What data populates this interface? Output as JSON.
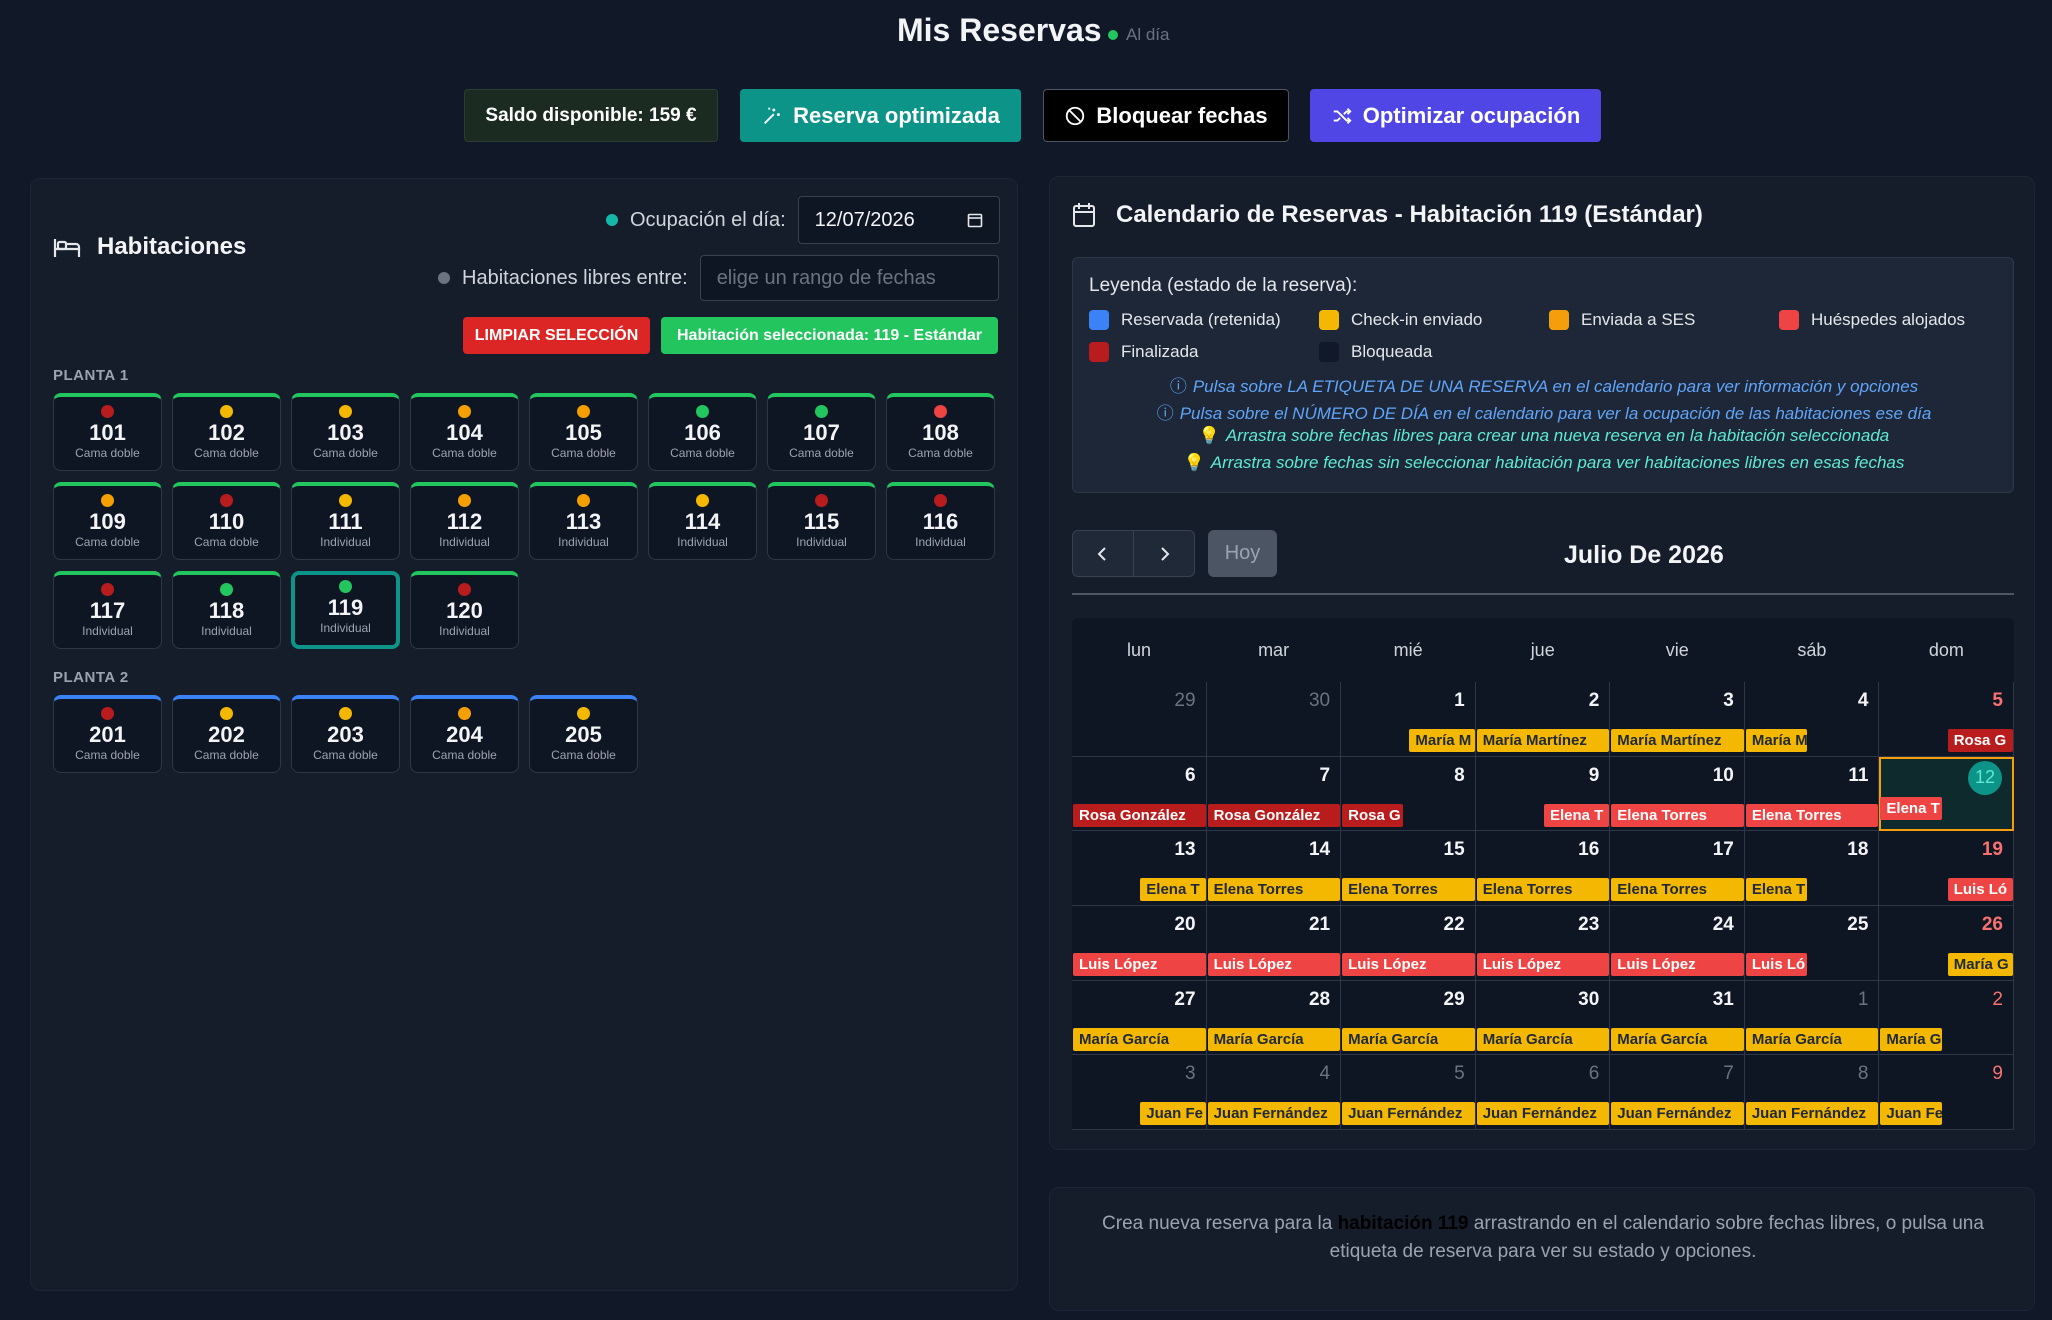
{
  "header": {
    "title": "Mis Reservas",
    "status": "Al día"
  },
  "toolbar": {
    "saldo": "Saldo disponible: 159 €",
    "reserva_optimizada": "Reserva optimizada",
    "bloquear_fechas": "Bloquear fechas",
    "optimizar_ocupacion": "Optimizar ocupación"
  },
  "rooms_panel": {
    "title": "Habitaciones",
    "occupancy_label": "Ocupación el día:",
    "occupancy_date": "12/07/2026",
    "free_label": "Habitaciones libres entre:",
    "free_placeholder": "elige un rango de fechas",
    "clear_button": "LIMPIAR SELECCIÓN",
    "selected_badge": "Habitación seleccionada: 119 - Estándar",
    "floors": [
      {
        "label": "PLANTA 1",
        "rooms": [
          {
            "number": "101",
            "type": "Cama doble",
            "status_color": "#b91c1c"
          },
          {
            "number": "102",
            "type": "Cama doble",
            "status_color": "#f5b800"
          },
          {
            "number": "103",
            "type": "Cama doble",
            "status_color": "#f5b800"
          },
          {
            "number": "104",
            "type": "Cama doble",
            "status_color": "#f5a000"
          },
          {
            "number": "105",
            "type": "Cama doble",
            "status_color": "#f5a000"
          },
          {
            "number": "106",
            "type": "Cama doble",
            "status_color": "#22c55e"
          },
          {
            "number": "107",
            "type": "Cama doble",
            "status_color": "#22c55e"
          },
          {
            "number": "108",
            "type": "Cama doble",
            "status_color": "#ef4444"
          },
          {
            "number": "109",
            "type": "Cama doble",
            "status_color": "#f5a000"
          },
          {
            "number": "110",
            "type": "Cama doble",
            "status_color": "#b91c1c"
          },
          {
            "number": "111",
            "type": "Individual",
            "status_color": "#f5b800"
          },
          {
            "number": "112",
            "type": "Individual",
            "status_color": "#f5a000"
          },
          {
            "number": "113",
            "type": "Individual",
            "status_color": "#f5a000"
          },
          {
            "number": "114",
            "type": "Individual",
            "status_color": "#f5b800"
          },
          {
            "number": "115",
            "type": "Individual",
            "status_color": "#b91c1c"
          },
          {
            "number": "116",
            "type": "Individual",
            "status_color": "#b91c1c"
          },
          {
            "number": "117",
            "type": "Individual",
            "status_color": "#b91c1c"
          },
          {
            "number": "118",
            "type": "Individual",
            "status_color": "#22c55e"
          },
          {
            "number": "119",
            "type": "Individual",
            "status_color": "#22c55e",
            "selected": true
          },
          {
            "number": "120",
            "type": "Individual",
            "status_color": "#b91c1c"
          }
        ]
      },
      {
        "label": "PLANTA 2",
        "rooms": [
          {
            "number": "201",
            "type": "Cama doble",
            "status_color": "#b91c1c"
          },
          {
            "number": "202",
            "type": "Cama doble",
            "status_color": "#f5b800"
          },
          {
            "number": "203",
            "type": "Cama doble",
            "status_color": "#f5b800"
          },
          {
            "number": "204",
            "type": "Cama doble",
            "status_color": "#f5a000"
          },
          {
            "number": "205",
            "type": "Cama doble",
            "status_color": "#f5b800"
          }
        ]
      }
    ]
  },
  "calendar": {
    "title": "Calendario de Reservas - Habitación 119 (Estándar)",
    "legend_title": "Leyenda (estado de la reserva):",
    "legend": [
      {
        "label": "Reservada (retenida)",
        "color": "#3b82f6"
      },
      {
        "label": "Check-in enviado",
        "color": "#f5b800"
      },
      {
        "label": "Enviada a SES",
        "color": "#f59e0b"
      },
      {
        "label": "Huéspedes alojados",
        "color": "#ef4444"
      },
      {
        "label": "Finalizada",
        "color": "#b91c1c"
      },
      {
        "label": "Bloqueada",
        "color": "#111827"
      }
    ],
    "hints": [
      "Pulsa sobre LA ETIQUETA DE UNA RESERVA en el calendario para ver información y opciones",
      "Pulsa sobre el NÚMERO DE DÍA en el calendario para ver la ocupación de las habitaciones ese día",
      "Arrastra sobre fechas libres para crear una nueva reserva en la habitación seleccionada",
      "Arrastra sobre fechas sin seleccionar habitación para ver habitaciones libres en esas fechas"
    ],
    "today_button": "Hoy",
    "month_title": "Julio De 2026",
    "weekdays": [
      "lun",
      "mar",
      "mié",
      "jue",
      "vie",
      "sáb",
      "dom"
    ],
    "weeks": [
      [
        {
          "d": "29",
          "o": true
        },
        {
          "d": "30",
          "o": true
        },
        {
          "d": "1"
        },
        {
          "d": "2"
        },
        {
          "d": "3"
        },
        {
          "d": "4"
        },
        {
          "d": "5"
        }
      ],
      [
        {
          "d": "6"
        },
        {
          "d": "7"
        },
        {
          "d": "8"
        },
        {
          "d": "9"
        },
        {
          "d": "10"
        },
        {
          "d": "11"
        },
        {
          "d": "12",
          "today": true
        }
      ],
      [
        {
          "d": "13"
        },
        {
          "d": "14"
        },
        {
          "d": "15"
        },
        {
          "d": "16"
        },
        {
          "d": "17"
        },
        {
          "d": "18"
        },
        {
          "d": "19"
        }
      ],
      [
        {
          "d": "20"
        },
        {
          "d": "21"
        },
        {
          "d": "22"
        },
        {
          "d": "23"
        },
        {
          "d": "24"
        },
        {
          "d": "25"
        },
        {
          "d": "26"
        }
      ],
      [
        {
          "d": "27"
        },
        {
          "d": "28"
        },
        {
          "d": "29"
        },
        {
          "d": "30"
        },
        {
          "d": "31"
        },
        {
          "d": "1",
          "o": true
        },
        {
          "d": "2",
          "o": true
        }
      ],
      [
        {
          "d": "3",
          "o": true
        },
        {
          "d": "4",
          "o": true
        },
        {
          "d": "5",
          "o": true
        },
        {
          "d": "6",
          "o": true
        },
        {
          "d": "7",
          "o": true
        },
        {
          "d": "8",
          "o": true
        },
        {
          "d": "9",
          "o": true
        }
      ]
    ],
    "events": [
      {
        "week": 0,
        "col": 2,
        "start": 0.5,
        "end": 1,
        "label": "María M",
        "color": "yellow"
      },
      {
        "week": 0,
        "col": 3,
        "start": 0,
        "end": 1,
        "label": "María Martínez",
        "color": "yellow"
      },
      {
        "week": 0,
        "col": 4,
        "start": 0,
        "end": 1,
        "label": "María Martínez",
        "color": "yellow"
      },
      {
        "week": 0,
        "col": 5,
        "start": 0,
        "end": 0.47,
        "label": "María M",
        "color": "yellow"
      },
      {
        "week": 0,
        "col": 6,
        "start": 0.5,
        "end": 1,
        "label": "Rosa G",
        "color": "dark"
      },
      {
        "week": 1,
        "col": 0,
        "start": 0,
        "end": 1,
        "label": "Rosa González",
        "color": "dark"
      },
      {
        "week": 1,
        "col": 1,
        "start": 0,
        "end": 1,
        "label": "Rosa González",
        "color": "dark"
      },
      {
        "week": 1,
        "col": 2,
        "start": 0,
        "end": 0.47,
        "label": "Rosa G",
        "color": "dark"
      },
      {
        "week": 1,
        "col": 3,
        "start": 0.5,
        "end": 1,
        "label": "Elena T",
        "color": "red"
      },
      {
        "week": 1,
        "col": 4,
        "start": 0,
        "end": 1,
        "label": "Elena Torres",
        "color": "red"
      },
      {
        "week": 1,
        "col": 5,
        "start": 0,
        "end": 1,
        "label": "Elena Torres",
        "color": "red"
      },
      {
        "week": 1,
        "col": 6,
        "start": 0,
        "end": 0.47,
        "label": "Elena T",
        "color": "red",
        "up": true
      },
      {
        "week": 2,
        "col": 0,
        "start": 0.5,
        "end": 1,
        "label": "Elena T",
        "color": "yellow"
      },
      {
        "week": 2,
        "col": 1,
        "start": 0,
        "end": 1,
        "label": "Elena Torres",
        "color": "yellow"
      },
      {
        "week": 2,
        "col": 2,
        "start": 0,
        "end": 1,
        "label": "Elena Torres",
        "color": "yellow"
      },
      {
        "week": 2,
        "col": 3,
        "start": 0,
        "end": 1,
        "label": "Elena Torres",
        "color": "yellow"
      },
      {
        "week": 2,
        "col": 4,
        "start": 0,
        "end": 1,
        "label": "Elena Torres",
        "color": "yellow"
      },
      {
        "week": 2,
        "col": 5,
        "start": 0,
        "end": 0.47,
        "label": "Elena T",
        "color": "yellow"
      },
      {
        "week": 2,
        "col": 6,
        "start": 0.5,
        "end": 1,
        "label": "Luis Ló",
        "color": "red"
      },
      {
        "week": 3,
        "col": 0,
        "start": 0,
        "end": 1,
        "label": "Luis López",
        "color": "red"
      },
      {
        "week": 3,
        "col": 1,
        "start": 0,
        "end": 1,
        "label": "Luis López",
        "color": "red"
      },
      {
        "week": 3,
        "col": 2,
        "start": 0,
        "end": 1,
        "label": "Luis López",
        "color": "red"
      },
      {
        "week": 3,
        "col": 3,
        "start": 0,
        "end": 1,
        "label": "Luis López",
        "color": "red"
      },
      {
        "week": 3,
        "col": 4,
        "start": 0,
        "end": 1,
        "label": "Luis López",
        "color": "red"
      },
      {
        "week": 3,
        "col": 5,
        "start": 0,
        "end": 0.47,
        "label": "Luis Ló",
        "color": "red"
      },
      {
        "week": 3,
        "col": 6,
        "start": 0.5,
        "end": 1,
        "label": "María G",
        "color": "yellow"
      },
      {
        "week": 4,
        "col": 0,
        "start": 0,
        "end": 1,
        "label": "María García",
        "color": "yellow"
      },
      {
        "week": 4,
        "col": 1,
        "start": 0,
        "end": 1,
        "label": "María García",
        "color": "yellow"
      },
      {
        "week": 4,
        "col": 2,
        "start": 0,
        "end": 1,
        "label": "María García",
        "color": "yellow"
      },
      {
        "week": 4,
        "col": 3,
        "start": 0,
        "end": 1,
        "label": "María García",
        "color": "yellow"
      },
      {
        "week": 4,
        "col": 4,
        "start": 0,
        "end": 1,
        "label": "María García",
        "color": "yellow"
      },
      {
        "week": 4,
        "col": 5,
        "start": 0,
        "end": 1,
        "label": "María García",
        "color": "yellow"
      },
      {
        "week": 4,
        "col": 6,
        "start": 0,
        "end": 0.47,
        "label": "María G",
        "color": "yellow"
      },
      {
        "week": 5,
        "col": 0,
        "start": 0.5,
        "end": 1,
        "label": "Juan Fe",
        "color": "yellow"
      },
      {
        "week": 5,
        "col": 1,
        "start": 0,
        "end": 1,
        "label": "Juan Fernández",
        "color": "yellow"
      },
      {
        "week": 5,
        "col": 2,
        "start": 0,
        "end": 1,
        "label": "Juan Fernández",
        "color": "yellow"
      },
      {
        "week": 5,
        "col": 3,
        "start": 0,
        "end": 1,
        "label": "Juan Fernández",
        "color": "yellow"
      },
      {
        "week": 5,
        "col": 4,
        "start": 0,
        "end": 1,
        "label": "Juan Fernández",
        "color": "yellow"
      },
      {
        "week": 5,
        "col": 5,
        "start": 0,
        "end": 1,
        "label": "Juan Fernández",
        "color": "yellow"
      },
      {
        "week": 5,
        "col": 6,
        "start": 0,
        "end": 0.47,
        "label": "Juan Fe",
        "color": "yellow"
      }
    ]
  },
  "info": {
    "text_before": "Crea nueva reserva para la ",
    "highlight": "habitación 119",
    "text_after": " arrastrando en el calendario sobre fechas libres, o pulsa una etiqueta de reserva para ver su estado y opciones."
  }
}
